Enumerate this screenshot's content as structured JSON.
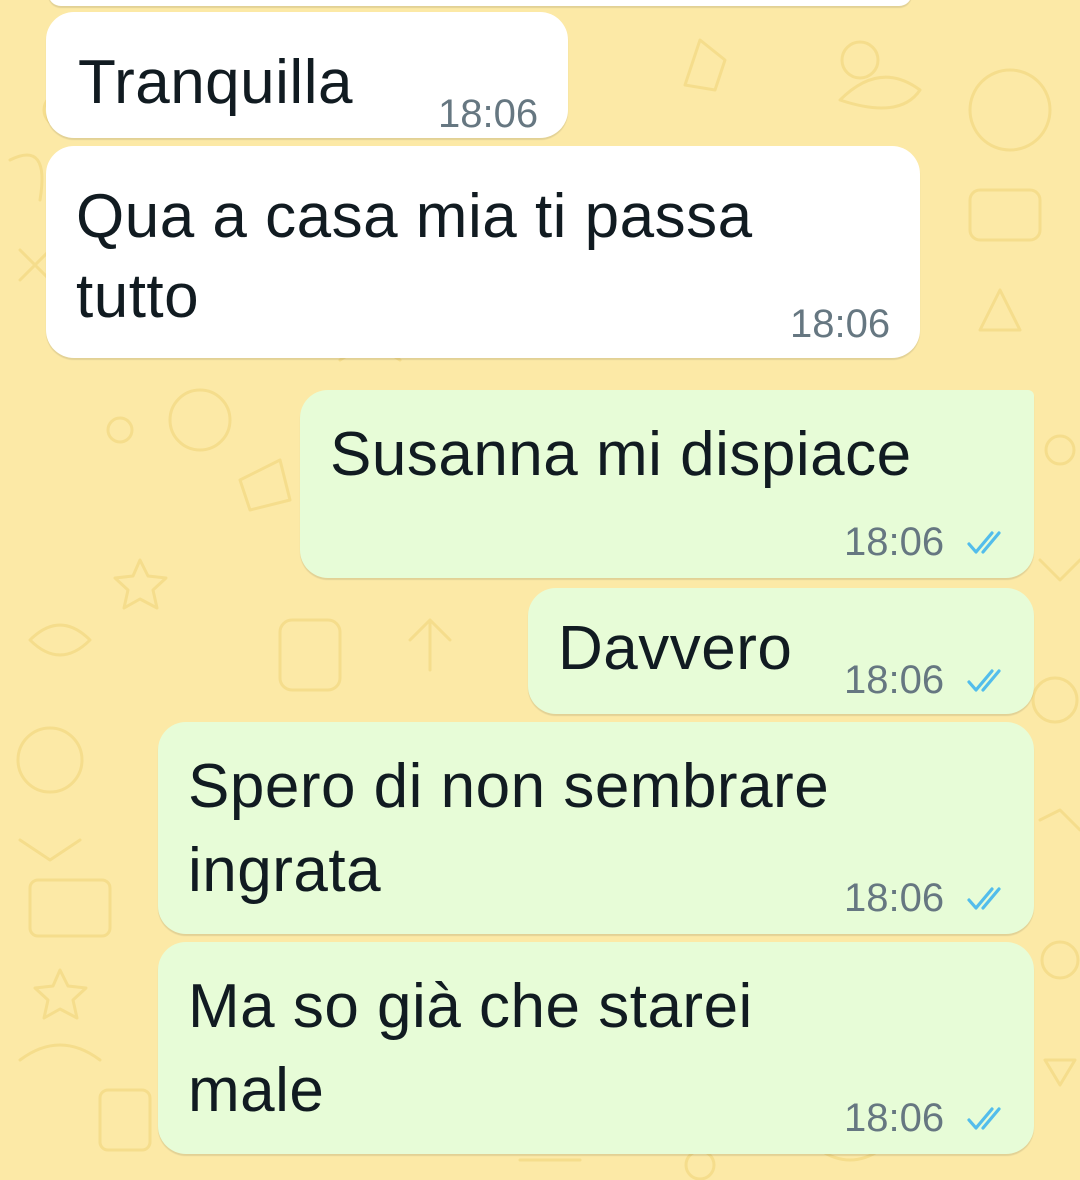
{
  "colors": {
    "wallpaper": "#fce9a6",
    "incoming_bubble": "#ffffff",
    "outgoing_bubble": "#e7fcd7",
    "timestamp": "#667781",
    "read_ticks": "#53bdeb"
  },
  "messages": [
    {
      "direction": "incoming",
      "lines": [
        "Tranquilla"
      ],
      "time": "18:06"
    },
    {
      "direction": "incoming",
      "lines": [
        "Qua a casa mia ti passa",
        "tutto"
      ],
      "time": "18:06"
    },
    {
      "direction": "outgoing",
      "lines": [
        "Susanna mi dispiace"
      ],
      "time": "18:06",
      "status_icon": "double-check-read-icon"
    },
    {
      "direction": "outgoing",
      "lines": [
        "Davvero"
      ],
      "time": "18:06",
      "status_icon": "double-check-read-icon"
    },
    {
      "direction": "outgoing",
      "lines": [
        "Spero di non sembrare",
        "ingrata"
      ],
      "time": "18:06",
      "status_icon": "double-check-read-icon"
    },
    {
      "direction": "outgoing",
      "lines": [
        "Ma so già che starei",
        "male"
      ],
      "time": "18:06",
      "status_icon": "double-check-read-icon"
    }
  ]
}
